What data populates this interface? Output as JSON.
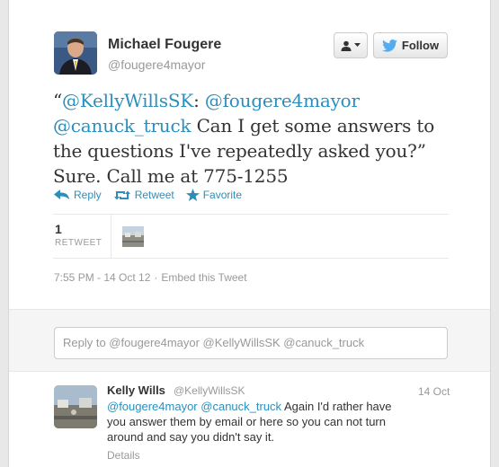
{
  "author": {
    "name": "Michael Fougere",
    "handle": "@fougere4mayor"
  },
  "follow_button": {
    "label": "Follow"
  },
  "tweet": {
    "open_quote": "“",
    "mention1": "@KellyWillsSK",
    "colon": ":",
    "mention2": "@fougere4mayor",
    "mention3": "@canuck_truck",
    "body": " Can I get some answers to the questions I've repeatedly asked you?” Sure. Call me at 775-1255"
  },
  "actions": {
    "reply": "Reply",
    "retweet": "Retweet",
    "favorite": "Favorite"
  },
  "stats": {
    "retweet_count": "1",
    "retweet_label": "RETWEET"
  },
  "meta": {
    "timestamp": "7:55 PM - 14 Oct 12",
    "separator": "·",
    "embed": "Embed this Tweet"
  },
  "reply_box": {
    "placeholder": "Reply to @fougere4mayor @KellyWillsSK @canuck_truck"
  },
  "reply_tweet": {
    "name": "Kelly Wills",
    "handle": "@KellyWillsSK",
    "time": "14 Oct",
    "mention1": "@fougere4mayor",
    "mention2": "@canuck_truck",
    "body": " Again I'd rather have you answer them by email or here so you can not turn around and say you didn't say it.",
    "details": "Details"
  },
  "colors": {
    "link": "#2a8fbd",
    "twitter_bird": "#55acee",
    "muted": "#999999"
  },
  "icons": [
    "user-icon",
    "chevron-down-icon",
    "twitter-bird-icon",
    "reply-icon",
    "retweet-icon",
    "star-icon"
  ]
}
